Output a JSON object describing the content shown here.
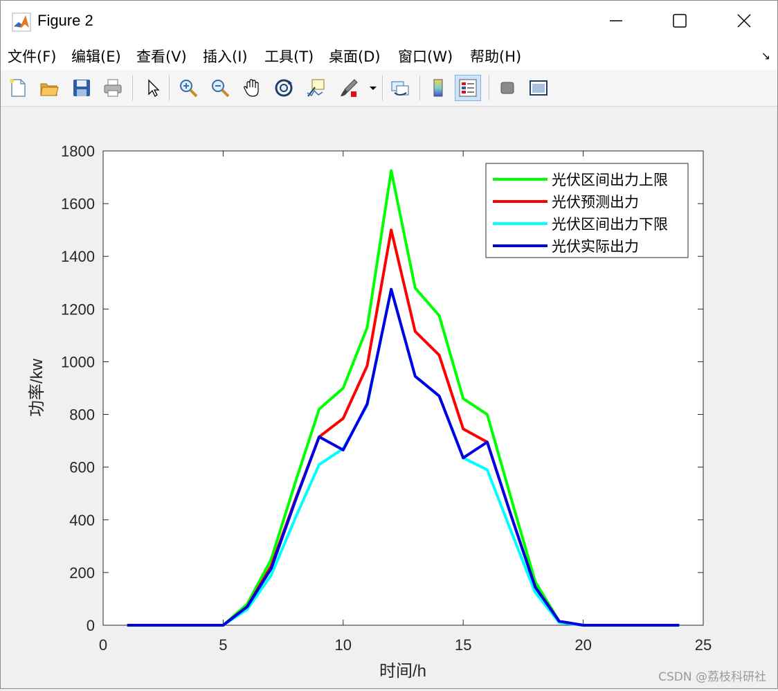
{
  "window": {
    "title": "Figure 2",
    "icons": [
      "matlab-logo-icon",
      "minimize-icon",
      "maximize-icon",
      "close-icon"
    ]
  },
  "menu": {
    "items": [
      "文件(F)",
      "编辑(E)",
      "查看(V)",
      "插入(I)",
      "工具(T)",
      "桌面(D)",
      "窗口(W)",
      "帮助(H)"
    ],
    "dock_arrow": "↘"
  },
  "toolbar": {
    "buttons": [
      "new-figure-icon",
      "open-file-icon",
      "save-icon",
      "print-icon",
      "pointer-icon",
      "zoom-in-icon",
      "zoom-out-icon",
      "pan-hand-icon",
      "rotate-3d-icon",
      "data-cursor-icon",
      "brush-icon",
      "link-plot-icon",
      "colorbar-icon",
      "legend-icon",
      "hide-tools-icon",
      "show-tools-icon"
    ]
  },
  "watermark": "CSDN @荔枝科研社",
  "chart_data": {
    "type": "line",
    "title": "",
    "xlabel": "时间/h",
    "ylabel": "功率/kw",
    "xlim": [
      0,
      25
    ],
    "ylim": [
      0,
      1800
    ],
    "xticks": [
      0,
      5,
      10,
      15,
      20,
      25
    ],
    "yticks": [
      0,
      200,
      400,
      600,
      800,
      1000,
      1200,
      1400,
      1600,
      1800
    ],
    "grid": false,
    "legend_position": "top-right",
    "x": [
      1,
      2,
      3,
      4,
      5,
      6,
      7,
      8,
      9,
      10,
      11,
      12,
      13,
      14,
      15,
      16,
      17,
      18,
      19,
      20,
      21,
      22,
      23,
      24
    ],
    "series": [
      {
        "name": "光伏区间出力上限",
        "color": "#00ff00",
        "values": [
          0,
          0,
          0,
          0,
          0,
          80,
          250,
          540,
          820,
          900,
          1130,
          1725,
          1280,
          1175,
          860,
          800,
          480,
          165,
          15,
          0,
          0,
          0,
          0,
          0
        ]
      },
      {
        "name": "光伏预测出力",
        "color": "#ff0000",
        "values": [
          0,
          0,
          0,
          0,
          0,
          70,
          225,
          475,
          715,
          785,
          985,
          1500,
          1115,
          1025,
          745,
          695,
          415,
          145,
          15,
          0,
          0,
          0,
          0,
          0
        ]
      },
      {
        "name": "光伏区间出力下限",
        "color": "#00ffff",
        "values": [
          0,
          0,
          0,
          0,
          0,
          60,
          190,
          405,
          610,
          670,
          835,
          1275,
          945,
          870,
          635,
          590,
          355,
          125,
          10,
          0,
          0,
          0,
          0,
          0
        ]
      },
      {
        "name": "光伏实际出力",
        "color": "#0000e0",
        "values": [
          0,
          0,
          0,
          0,
          0,
          70,
          215,
          470,
          715,
          665,
          840,
          1275,
          945,
          870,
          635,
          695,
          415,
          145,
          15,
          0,
          0,
          0,
          0,
          0
        ]
      }
    ]
  }
}
